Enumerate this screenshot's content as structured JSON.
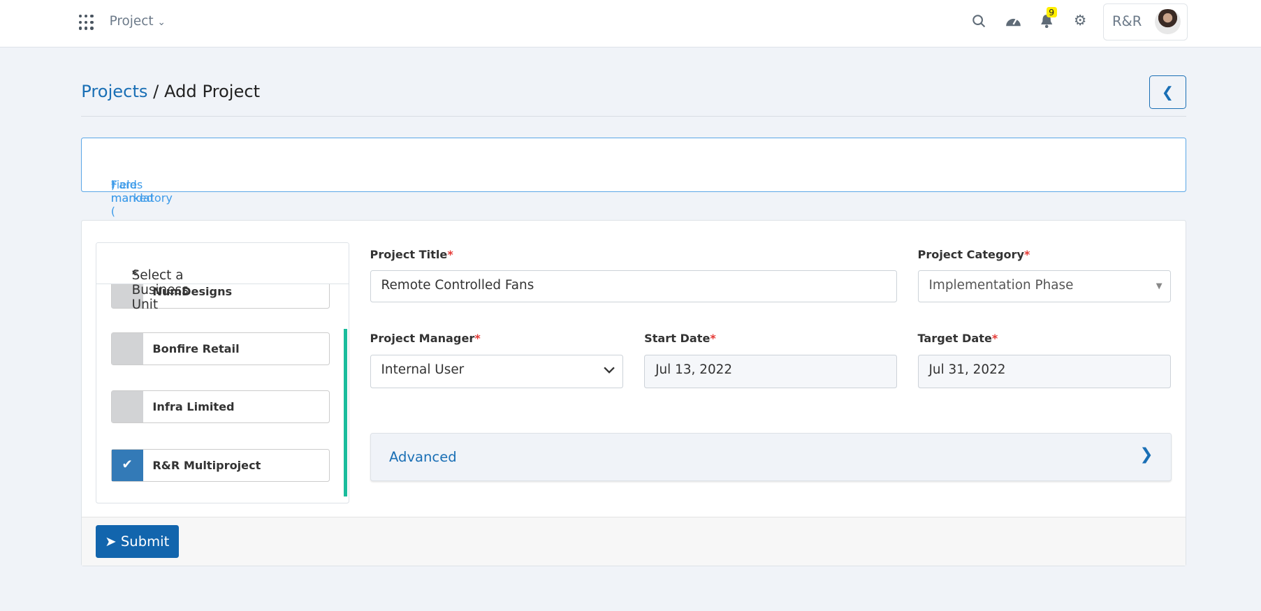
{
  "topbar": {
    "app_menu_label": "Project",
    "user_label": "R&R",
    "notification_count": "9",
    "icons": [
      "apps-grid-icon",
      "chevron-down-icon",
      "search-icon",
      "dashboard-gauge-icon",
      "bell-icon",
      "gear-icon"
    ]
  },
  "breadcrumb": {
    "parent": "Projects",
    "separator": " / ",
    "current": "Add Project"
  },
  "info": {
    "prefix": "Fields marked (",
    "star": "*",
    "suffix": ") are mandatory"
  },
  "business_units": {
    "title": "Select a Business Unit",
    "items": [
      {
        "label": "NumDesigns",
        "checked": false
      },
      {
        "label": "Bonfire Retail",
        "checked": false
      },
      {
        "label": "Infra Limited",
        "checked": false
      },
      {
        "label": "R&R Multiproject",
        "checked": true
      }
    ]
  },
  "form": {
    "project_title": {
      "label": "Project Title",
      "value": "Remote Controlled Fans"
    },
    "project_category": {
      "label": "Project Category",
      "value": "Implementation Phase"
    },
    "project_manager": {
      "label": "Project Manager",
      "value": "Internal User"
    },
    "start_date": {
      "label": "Start Date",
      "value": "Jul 13, 2022"
    },
    "target_date": {
      "label": "Target Date",
      "value": "Jul 31, 2022"
    },
    "required_mark": "*"
  },
  "advanced": {
    "label": "Advanced"
  },
  "submit": {
    "label": "Submit"
  },
  "colors": {
    "primary": "#1265ad",
    "link": "#1a6fb5",
    "required": "#e53935",
    "scrollbar": "#1abc9c",
    "badge": "#ffee00"
  }
}
